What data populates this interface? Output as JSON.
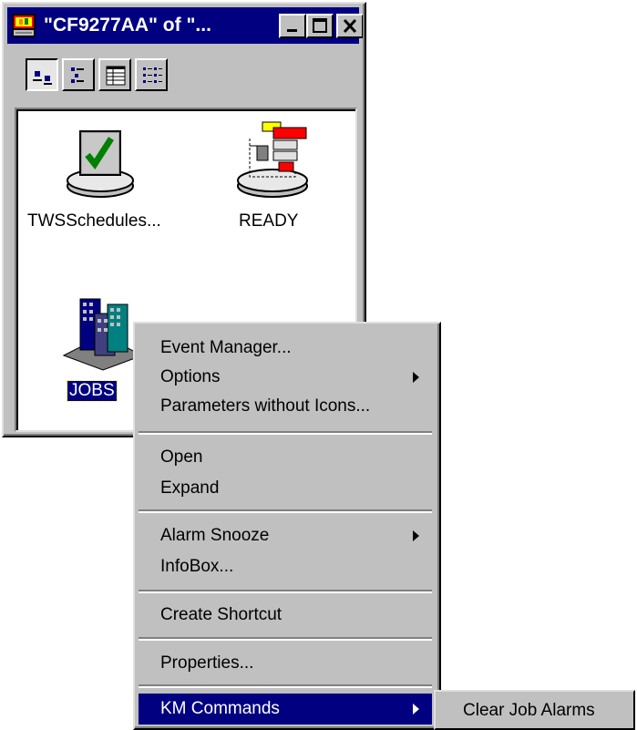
{
  "window": {
    "title": "\"CF9277AA\" of \"...",
    "controls": [
      "minimize-icon",
      "maximize-icon",
      "close-icon"
    ]
  },
  "toolbar": {
    "buttons": [
      "large-icons-view-icon",
      "small-icons-view-icon",
      "details-view-icon",
      "list-view-icon"
    ],
    "pressed": 0
  },
  "icons": [
    {
      "label": "TWSSchedules...",
      "icon": "checkmark-server-icon"
    },
    {
      "label": "READY",
      "icon": "status-flowchart-icon"
    },
    {
      "label": "JOBS",
      "icon": "jobs-buildings-icon",
      "selected": true
    }
  ],
  "context_menu": {
    "items": [
      {
        "label": "Event Manager..."
      },
      {
        "label": "Options",
        "submenu": true
      },
      {
        "label": "Parameters without Icons..."
      },
      {
        "label": "Open"
      },
      {
        "label": "Expand"
      },
      {
        "label": "Alarm Snooze",
        "submenu": true
      },
      {
        "label": "InfoBox..."
      },
      {
        "label": "Create Shortcut"
      },
      {
        "label": "Properties..."
      },
      {
        "label": "KM Commands",
        "submenu": true,
        "highlighted": true
      }
    ]
  },
  "submenu": {
    "items": [
      {
        "label": "Clear Job Alarms"
      }
    ]
  },
  "colors": {
    "titlebar": "#000080",
    "face": "#c0c0c0",
    "highlight": "#000080"
  }
}
